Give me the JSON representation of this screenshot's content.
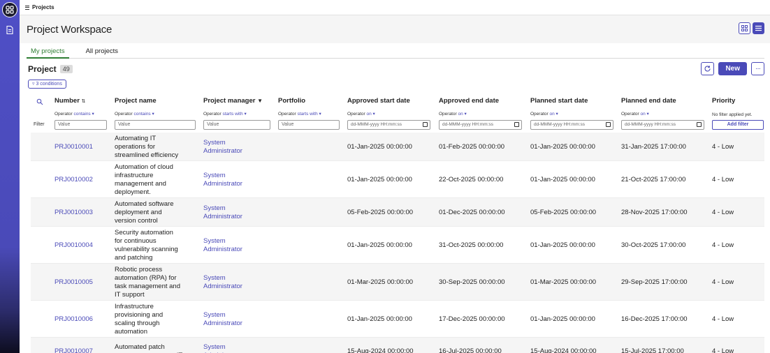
{
  "topbar": {
    "breadcrumb": "Projects"
  },
  "header": {
    "title": "Project Workspace"
  },
  "tabs": [
    {
      "label": "My projects",
      "active": true
    },
    {
      "label": "All projects",
      "active": false
    }
  ],
  "list": {
    "title": "Project",
    "count": "49",
    "conditions_label": "3 conditions",
    "new_button": "New"
  },
  "columns": {
    "number": "Number",
    "name": "Project name",
    "manager": "Project manager",
    "portfolio": "Portfolio",
    "approved_start": "Approved start date",
    "approved_end": "Approved end date",
    "planned_start": "Planned start date",
    "planned_end": "Planned end date",
    "priority": "Priority"
  },
  "filters": {
    "label": "Filter",
    "operator_prefix": "Operator",
    "number_op": "contains",
    "name_op": "contains",
    "manager_op": "starts with",
    "portfolio_op": "starts with",
    "approved_start_op": "on",
    "approved_end_op": "on",
    "planned_start_op": "on",
    "planned_end_op": "on",
    "value_placeholder": "Value",
    "date_placeholder": "dd-MMM-yyyy HH:mm:ss",
    "priority_note": "No filter applied yet.",
    "add_filter": "Add filter"
  },
  "rows": [
    {
      "number": "PRJ0010001",
      "name": [
        "Automating IT",
        "operations for",
        "streamlined efficiency"
      ],
      "manager": [
        "System",
        "Administrator"
      ],
      "approved_start": "01-Jan-2025 00:00:00",
      "approved_end": "01-Feb-2025 00:00:00",
      "planned_start": "01-Jan-2025 00:00:00",
      "planned_end": "31-Jan-2025 17:00:00",
      "priority": "4 - Low"
    },
    {
      "number": "PRJ0010002",
      "name": [
        "Automation of cloud",
        "infrastructure",
        "management and",
        "deployment."
      ],
      "manager": [
        "System",
        "Administrator"
      ],
      "approved_start": "01-Jan-2025 00:00:00",
      "approved_end": "22-Oct-2025 00:00:00",
      "planned_start": "01-Jan-2025 00:00:00",
      "planned_end": "21-Oct-2025 17:00:00",
      "priority": "4 - Low"
    },
    {
      "number": "PRJ0010003",
      "name": [
        "Automated software",
        "deployment and",
        "version control"
      ],
      "manager": [
        "System",
        "Administrator"
      ],
      "approved_start": "05-Feb-2025 00:00:00",
      "approved_end": "01-Dec-2025 00:00:00",
      "planned_start": "05-Feb-2025 00:00:00",
      "planned_end": "28-Nov-2025 17:00:00",
      "priority": "4 - Low"
    },
    {
      "number": "PRJ0010004",
      "name": [
        "Security automation",
        "for continuous",
        "vulnerability scanning",
        "and patching"
      ],
      "manager": [
        "System",
        "Administrator"
      ],
      "approved_start": "01-Jan-2025 00:00:00",
      "approved_end": "31-Oct-2025 00:00:00",
      "planned_start": "01-Jan-2025 00:00:00",
      "planned_end": "30-Oct-2025 17:00:00",
      "priority": "4 - Low"
    },
    {
      "number": "PRJ0010005",
      "name": [
        "Robotic process",
        "automation (RPA) for",
        "task management and",
        "IT support"
      ],
      "manager": [
        "System",
        "Administrator"
      ],
      "approved_start": "01-Mar-2025 00:00:00",
      "approved_end": "30-Sep-2025 00:00:00",
      "planned_start": "01-Mar-2025 00:00:00",
      "planned_end": "29-Sep-2025 17:00:00",
      "priority": "4 - Low"
    },
    {
      "number": "PRJ0010006",
      "name": [
        "Infrastructure",
        "provisioning and",
        "scaling through",
        "automation"
      ],
      "manager": [
        "System",
        "Administrator"
      ],
      "approved_start": "01-Jan-2025 00:00:00",
      "approved_end": "17-Dec-2025 00:00:00",
      "planned_start": "01-Jan-2025 00:00:00",
      "planned_end": "16-Dec-2025 17:00:00",
      "priority": "4 - Low"
    },
    {
      "number": "PRJ0010007",
      "name": [
        "Automated patch",
        "management across IT"
      ],
      "manager": [
        "System",
        "Administrator"
      ],
      "approved_start": "15-Aug-2024 00:00:00",
      "approved_end": "16-Jul-2025 00:00:00",
      "planned_start": "15-Aug-2024 00:00:00",
      "planned_end": "15-Jul-2025 17:00:00",
      "priority": "4 - Low"
    }
  ]
}
